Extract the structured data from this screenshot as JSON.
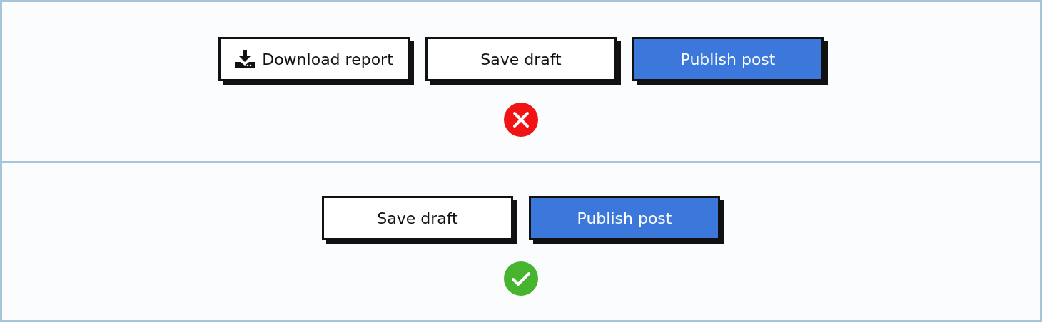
{
  "panels": [
    {
      "buttons": [
        {
          "label": "Download report",
          "kind": "iconic"
        },
        {
          "label": "Save draft",
          "kind": "plain"
        },
        {
          "label": "Publish post",
          "kind": "primary"
        }
      ],
      "correct": false
    },
    {
      "buttons": [
        {
          "label": "Save draft",
          "kind": "plain"
        },
        {
          "label": "Publish post",
          "kind": "primary"
        }
      ],
      "correct": true
    }
  ]
}
